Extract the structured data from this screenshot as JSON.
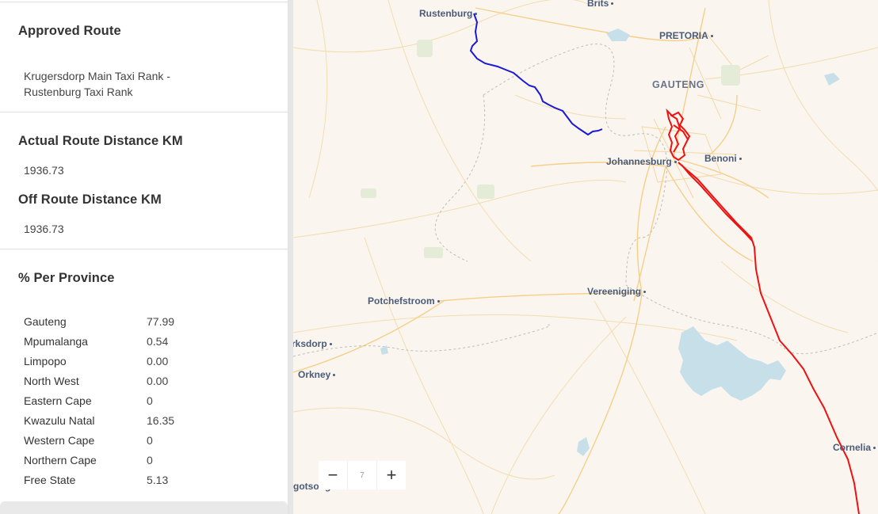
{
  "panel": {
    "approved_route_title": "Approved Route",
    "approved_route_value": "Krugersdorp Main Taxi Rank - Rustenburg Taxi Rank",
    "actual_distance_title": "Actual Route Distance KM",
    "actual_distance_value": "1936.73",
    "off_route_title": "Off Route Distance KM",
    "off_route_value": "1936.73",
    "province_title": "% Per Province",
    "provinces": [
      {
        "name": "Gauteng",
        "value": "77.99"
      },
      {
        "name": "Mpumalanga",
        "value": "0.54"
      },
      {
        "name": "Limpopo",
        "value": "0.00"
      },
      {
        "name": "North West",
        "value": "0.00"
      },
      {
        "name": "Eastern Cape",
        "value": "0"
      },
      {
        "name": "Kwazulu Natal",
        "value": "16.35"
      },
      {
        "name": "Western Cape",
        "value": "0"
      },
      {
        "name": "Northern Cape",
        "value": "0"
      },
      {
        "name": "Free State",
        "value": "5.13"
      }
    ]
  },
  "map": {
    "places": {
      "brits": "Brits",
      "rustenburg": "Rustenburg",
      "pretoria": "PRETORIA",
      "gauteng": "GAUTENG",
      "johannesburg": "Johannesburg",
      "benoni": "Benoni",
      "potchefstroom": "Potchefstroom",
      "vereeniging": "Vereeniging",
      "klerksdorp": "rksdorp",
      "orkney": "Orkney",
      "cornelia": "Cornelia",
      "kgotsong": "gotsong"
    },
    "zoom": {
      "out_label": "−",
      "level": "7",
      "in_label": "+"
    },
    "colors": {
      "approved_route": "#1a1ad6",
      "actual_route": "#ee1111",
      "background": "#faf6ef",
      "water": "#c6dfe8",
      "roads": "#f6d9a3"
    }
  }
}
